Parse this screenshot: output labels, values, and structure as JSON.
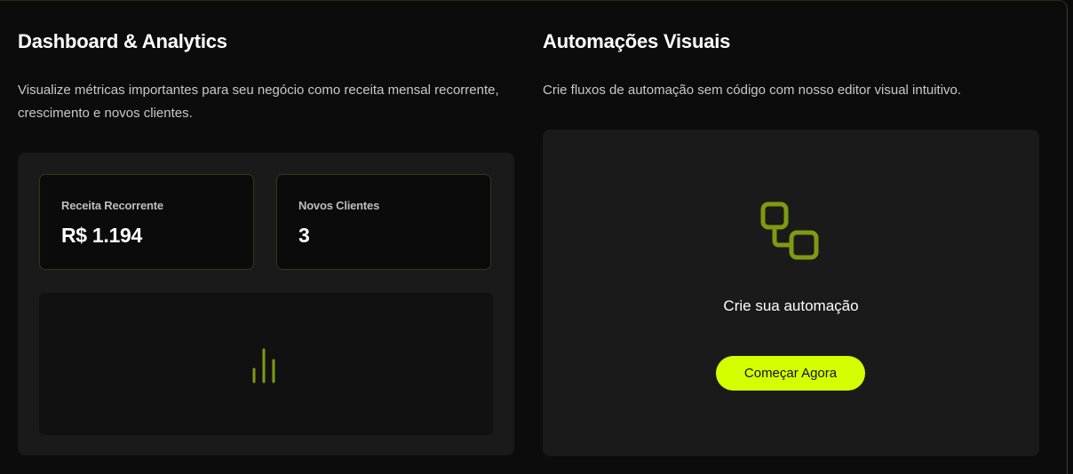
{
  "dashboard": {
    "title": "Dashboard & Analytics",
    "description": "Visualize métricas importantes para seu negócio como receita mensal recorrente, crescimento e novos clientes.",
    "metrics": [
      {
        "label": "Receita Recorrente",
        "value": "R$ 1.194"
      },
      {
        "label": "Novos Clientes",
        "value": "3"
      }
    ],
    "chart_icon": "bar-chart-icon"
  },
  "automations": {
    "title": "Automações Visuais",
    "description": "Crie fluxos de automação sem código com nosso editor visual intuitivo.",
    "icon": "workflow-icon",
    "caption": "Crie sua automação",
    "cta_label": "Começar Agora"
  },
  "colors": {
    "accent": "#d4ff00",
    "icon_accent": "#7f9a12",
    "background": "#0b0b0b",
    "panel": "#1a1a1a"
  }
}
